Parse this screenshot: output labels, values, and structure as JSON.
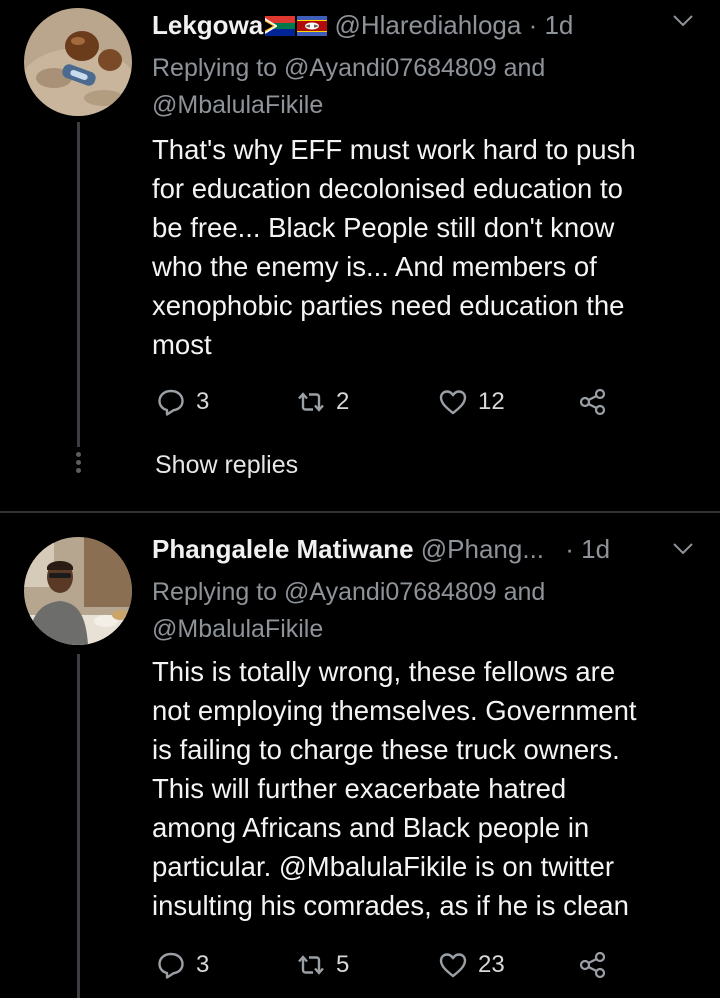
{
  "tweets": [
    {
      "name": "Lekgowa",
      "handle": "@Hlarediahloga",
      "time": "· 1d",
      "replying_to": "Replying to @Ayandi07684809 and",
      "replying_to_2": "@MbalulaFikile",
      "text": "That's why  EFF must work hard to push\nfor education decolonised education to\nbe free...  Black People still don't know\nwho the enemy is... And members of\nxenophobic parties need education the\nmost",
      "replies": "3",
      "retweets": "2",
      "likes": "12",
      "show_replies": "Show replies",
      "flags": [
        "south-africa-flag",
        "eswatini-flag"
      ]
    },
    {
      "name": "Phangalele Matiwane",
      "handle": "@Phang...",
      "time": "· 1d",
      "replying_to": "Replying to @Ayandi07684809 and",
      "replying_to_2": "@MbalulaFikile",
      "text_before_mention": "This is totally wrong, these fellows are\nnot employing themselves. Government\nis failing to charge these truck owners.\nThis will further exacerbate hatred\namong Africans and Black people in\nparticular. ",
      "text_mention": "@MbalulaFikile",
      "text_after_mention": " is on twitter\ninsulting his comrades, as if he is clean",
      "replies": "3",
      "retweets": "5",
      "likes": "23"
    }
  ],
  "icons": {
    "reply": "reply-icon",
    "retweet": "retweet-icon",
    "like": "heart-icon",
    "share": "share-icon",
    "more": "chevron-down-icon"
  },
  "colors": {
    "background": "#000000",
    "text": "#f4f4f4",
    "secondary": "#8e9399",
    "divider": "#2f3336"
  }
}
